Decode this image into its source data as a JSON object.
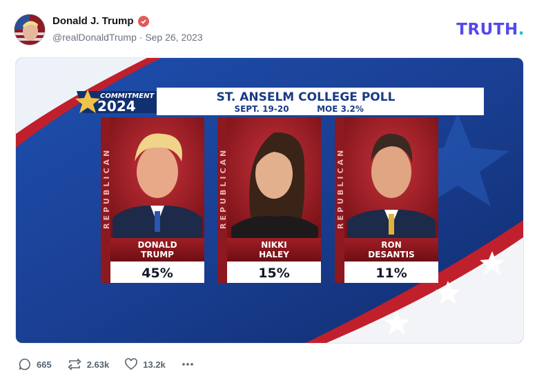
{
  "post": {
    "author_name": "Donald J. Trump",
    "handle": "@realDonaldTrump",
    "separator": "·",
    "date": "Sep 26, 2023",
    "verified_icon": "verified-check-icon",
    "logo_text": "TRUTH",
    "logo_dot": ".",
    "colors": {
      "brand": "#5448ee",
      "brand_accent": "#16c7b2",
      "verified": "#e05b5b"
    }
  },
  "graphic": {
    "badge_line1": "COMMITMENT",
    "badge_line2": "2024",
    "title": "ST. ANSELM COLLEGE POLL",
    "dates": "SEPT. 19-20",
    "moe": "MOE 3.2%",
    "side_label": "REPUBLICAN",
    "candidates": [
      {
        "first": "DONALD",
        "last": "TRUMP",
        "percent": "45%"
      },
      {
        "first": "NIKKI",
        "last": "HALEY",
        "percent": "15%"
      },
      {
        "first": "RON",
        "last": "DESANTIS",
        "percent": "11%"
      }
    ]
  },
  "actions": {
    "replies": "665",
    "retruths": "2.63k",
    "likes": "13.2k",
    "more_icon": "more-dots-icon"
  }
}
